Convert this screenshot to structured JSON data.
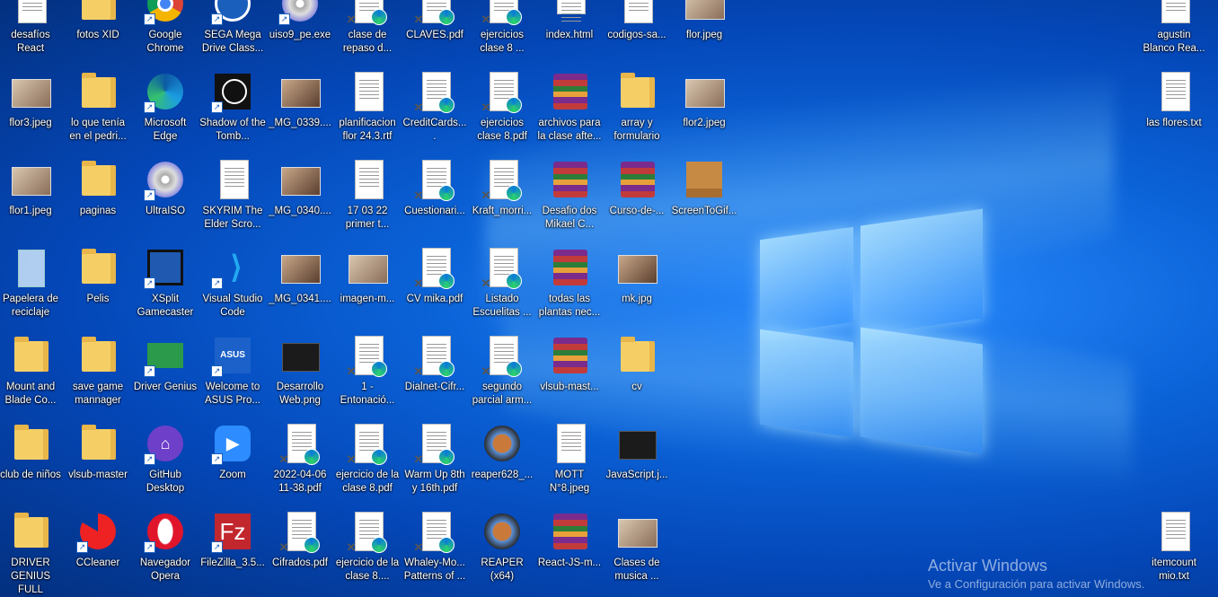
{
  "desktop": {
    "icons": [
      {
        "label": "desafíos React",
        "type": "doc"
      },
      {
        "label": "fotos XID",
        "type": "folder"
      },
      {
        "label": "Google Chrome",
        "type": "chrome"
      },
      {
        "label": "SEGA Mega Drive Class...",
        "type": "sega"
      },
      {
        "label": "uiso9_pe.exe",
        "type": "disc"
      },
      {
        "label": "clase de repaso d...",
        "type": "pdf"
      },
      {
        "label": "CLAVES.pdf",
        "type": "pdf"
      },
      {
        "label": "ejercicios clase 8 ...",
        "type": "pdf"
      },
      {
        "label": "index.html",
        "type": "html"
      },
      {
        "label": "codigos-sa...",
        "type": "pdfred"
      },
      {
        "label": "flor.jpeg",
        "type": "pic"
      },
      {
        "label": "flor3.jpeg",
        "type": "pic"
      },
      {
        "label": "lo que tenía en el pedri...",
        "type": "folder"
      },
      {
        "label": "Microsoft Edge",
        "type": "edge"
      },
      {
        "label": "Shadow of the Tomb...",
        "type": "tomb"
      },
      {
        "label": "_MG_0339....",
        "type": "photo"
      },
      {
        "label": "planificacion flor 24.3.rtf",
        "type": "doc"
      },
      {
        "label": "CreditCards....",
        "type": "pdf"
      },
      {
        "label": "ejercicios clase 8.pdf",
        "type": "pdf"
      },
      {
        "label": "archivos para la clase afte...",
        "type": "rar"
      },
      {
        "label": "array y formulario",
        "type": "folder"
      },
      {
        "label": "flor2.jpeg",
        "type": "pic"
      },
      {
        "label": "flor1.jpeg",
        "type": "pic"
      },
      {
        "label": "paginas",
        "type": "folder"
      },
      {
        "label": "UltraISO",
        "type": "disc"
      },
      {
        "label": "SKYRIM The Elder Scro...",
        "type": "doc"
      },
      {
        "label": "_MG_0340....",
        "type": "photo"
      },
      {
        "label": "17 03 22 primer t...",
        "type": "doc"
      },
      {
        "label": "Cuestionari...",
        "type": "pdf"
      },
      {
        "label": "Kraft_morri...",
        "type": "pdf"
      },
      {
        "label": "Desafio dos Mikael C...",
        "type": "rar"
      },
      {
        "label": "Curso-de-...",
        "type": "rar"
      },
      {
        "label": "ScreenToGif...",
        "type": "box"
      },
      {
        "label": "Papelera de reciclaje",
        "type": "bin"
      },
      {
        "label": "Pelis",
        "type": "folder"
      },
      {
        "label": "XSplit Gamecaster",
        "type": "xsplit"
      },
      {
        "label": "Visual Studio Code",
        "type": "vscode"
      },
      {
        "label": "_MG_0341....",
        "type": "photo"
      },
      {
        "label": "imagen-m...",
        "type": "pic"
      },
      {
        "label": "CV mika.pdf",
        "type": "pdf"
      },
      {
        "label": "Listado Escuelitas ...",
        "type": "pdf"
      },
      {
        "label": "todas las plantas nec...",
        "type": "rar"
      },
      {
        "label": "mk.jpg",
        "type": "photo"
      },
      {
        "label": "Mount and Blade Co...",
        "type": "folder"
      },
      {
        "label": "save game mannager",
        "type": "folder"
      },
      {
        "label": "Driver Genius",
        "type": "driver"
      },
      {
        "label": "Welcome to ASUS Pro...",
        "type": "asus"
      },
      {
        "label": "Desarrollo Web.png",
        "type": "dark"
      },
      {
        "label": "1 - Entonació...",
        "type": "pdf"
      },
      {
        "label": "Dialnet-Cifr...",
        "type": "pdf"
      },
      {
        "label": "segundo parcial arm...",
        "type": "pdf"
      },
      {
        "label": "vlsub-mast...",
        "type": "rar"
      },
      {
        "label": "cv",
        "type": "folder"
      },
      {
        "label": "club de niños",
        "type": "folder"
      },
      {
        "label": "vlsub-master",
        "type": "folder"
      },
      {
        "label": "GitHub Desktop",
        "type": "github"
      },
      {
        "label": "Zoom",
        "type": "zoom"
      },
      {
        "label": "2022-04-06 11-38.pdf",
        "type": "pdf"
      },
      {
        "label": "ejercicio de la clase 8.pdf",
        "type": "pdf"
      },
      {
        "label": "Warm Up 8th y 16th.pdf",
        "type": "pdf"
      },
      {
        "label": "reaper628_...",
        "type": "reaper"
      },
      {
        "label": "MOTT N°8.jpeg",
        "type": "doc"
      },
      {
        "label": "JavaScript.j...",
        "type": "dark"
      },
      {
        "label": "DRIVER GENIUS FULL",
        "type": "folder"
      },
      {
        "label": "CCleaner",
        "type": "ccleaner"
      },
      {
        "label": "Navegador Opera",
        "type": "opera"
      },
      {
        "label": "FileZilla_3.5...",
        "type": "filezilla"
      },
      {
        "label": "Cifrados.pdf",
        "type": "pdf"
      },
      {
        "label": "ejercicio de la clase 8....",
        "type": "pdf"
      },
      {
        "label": "Whaley-Mo... Patterns of ...",
        "type": "pdf"
      },
      {
        "label": "REAPER (x64)",
        "type": "reaper"
      },
      {
        "label": "React-JS-m...",
        "type": "rar"
      },
      {
        "label": "Clases de musica ...",
        "type": "pic"
      },
      {
        "label": "agustin Blanco Rea...",
        "type": "doc"
      },
      {
        "label": "las flores.txt",
        "type": "doc"
      },
      {
        "label": "itemcount mio.txt",
        "type": "doc"
      }
    ]
  },
  "watermark": {
    "line1": "Activar Windows",
    "line2": "Ve a Configuración para activar Windows."
  }
}
